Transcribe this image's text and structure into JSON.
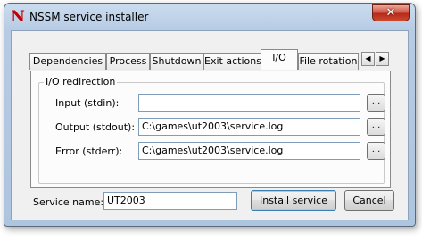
{
  "window": {
    "title": "NSSM service installer",
    "icon_letter": "N",
    "close_glyph": "✕"
  },
  "tabs": [
    {
      "label": "Dependencies",
      "active": false
    },
    {
      "label": "Process",
      "active": false
    },
    {
      "label": "Shutdown",
      "active": false
    },
    {
      "label": "Exit actions",
      "active": false
    },
    {
      "label": "I/O",
      "active": true
    },
    {
      "label": "File rotation",
      "active": false
    }
  ],
  "tab_scroll": {
    "left_glyph": "◀",
    "right_glyph": "▶"
  },
  "io": {
    "group_title": "I/O redirection",
    "fields": [
      {
        "label": "Input (stdin):",
        "value": "",
        "browse": "..."
      },
      {
        "label": "Output (stdout):",
        "value": "C:\\games\\ut2003\\service.log",
        "browse": "..."
      },
      {
        "label": "Error (stderr):",
        "value": "C:\\games\\ut2003\\service.log",
        "browse": "..."
      }
    ]
  },
  "service": {
    "label": "Service name:",
    "value": "UT2003"
  },
  "buttons": {
    "install": "Install service",
    "cancel": "Cancel"
  }
}
